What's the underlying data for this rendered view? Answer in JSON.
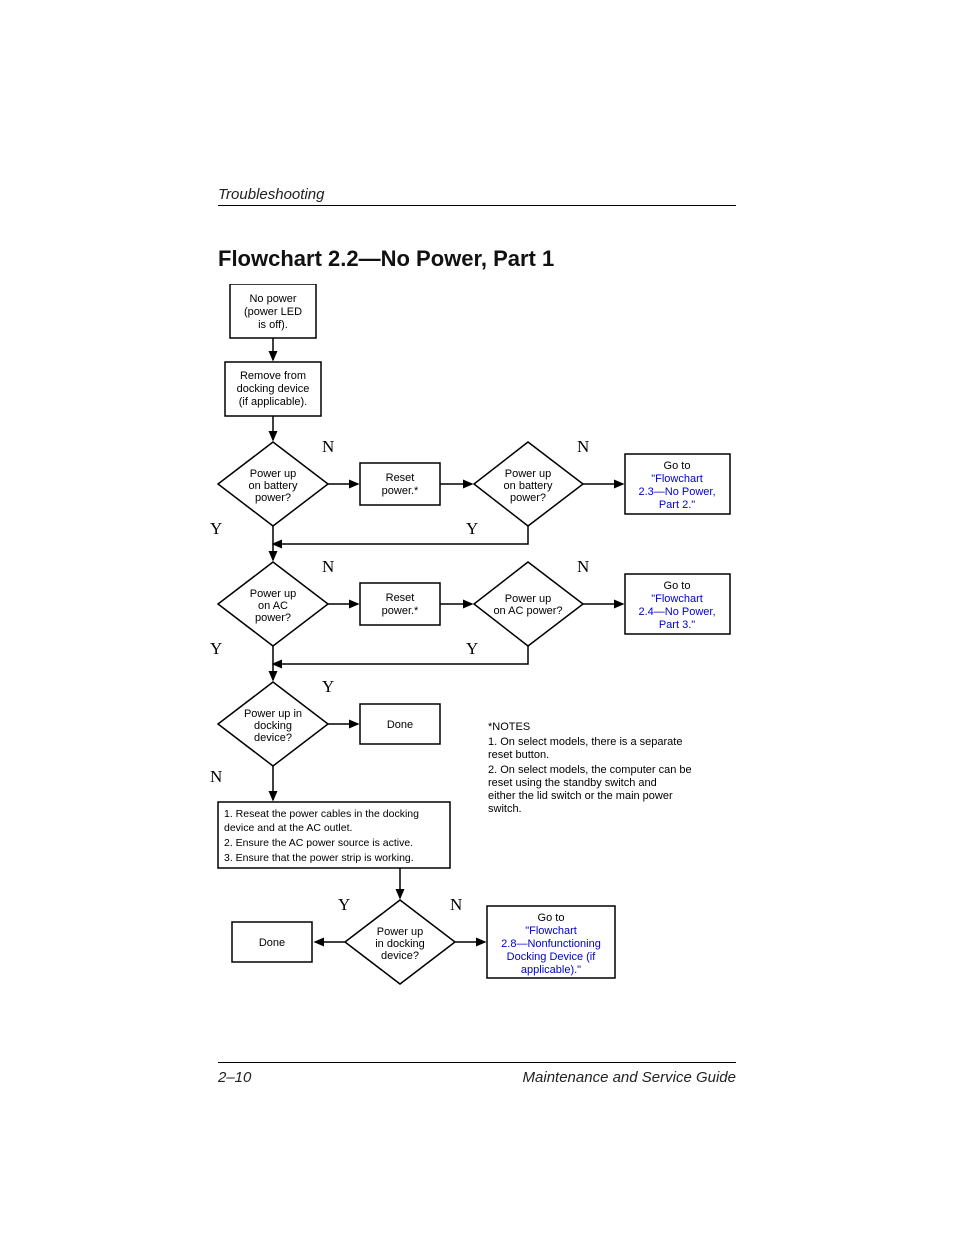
{
  "header": {
    "running": "Troubleshooting"
  },
  "title": "Flowchart 2.2—No Power, Part 1",
  "footer": {
    "page": "2–10",
    "book": "Maintenance and Service Guide"
  },
  "labels": {
    "Y": "Y",
    "N": "N"
  },
  "nodes": {
    "start": [
      "No power",
      "(power LED",
      "is off)."
    ],
    "remove": [
      "Remove from",
      "docking device",
      "(if applicable)."
    ],
    "d_batt1": [
      "Power up",
      "on battery",
      "power?"
    ],
    "reset1": [
      "Reset",
      "power.*"
    ],
    "d_batt2": [
      "Power up",
      "on battery",
      "power?"
    ],
    "goto23_a": "Go to",
    "goto23_b": [
      "\"Flowchart",
      "2.3—No Power,",
      "Part 2.\""
    ],
    "d_ac1": [
      "Power up",
      "on AC",
      "power?"
    ],
    "reset2": [
      "Reset",
      "power.*"
    ],
    "d_ac2": [
      "Power up",
      "on AC power?"
    ],
    "goto24_a": "Go to",
    "goto24_b": [
      "\"Flowchart",
      "2.4—No Power,",
      "Part 3.\""
    ],
    "d_dock1": [
      "Power up in",
      "docking",
      "device?"
    ],
    "done1": "Done",
    "instr": [
      "1. Reseat the power cables in the docking",
      "    device and at the AC outlet.",
      "2. Ensure the AC power source is active.",
      "3. Ensure that the power strip is working."
    ],
    "d_dock2": [
      "Power up",
      "in docking",
      "device?"
    ],
    "done2": "Done",
    "goto28_a": "Go to",
    "goto28_b": [
      "\"Flowchart",
      "2.8—Nonfunctioning",
      "Docking Device (if",
      "applicable).\""
    ]
  },
  "notes": {
    "head": "*NOTES",
    "n1": [
      "1. On select models, there is a separate",
      "    reset button."
    ],
    "n2": [
      "2. On select models, the computer can be",
      "    reset using the standby switch and",
      "    either the lid switch or the main power",
      "    switch."
    ]
  }
}
